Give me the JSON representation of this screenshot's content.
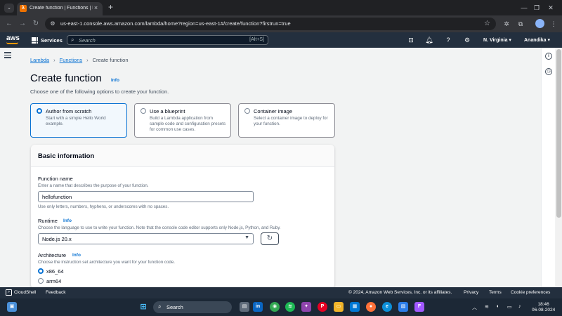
{
  "browser": {
    "tab_title": "Create function | Functions | Lambda",
    "url": "us-east-1.console.aws.amazon.com/lambda/home?region=us-east-1#/create/function?firstrun=true"
  },
  "aws_nav": {
    "logo": "aws",
    "services": "Services",
    "search_placeholder": "Search",
    "search_shortcut": "[Alt+S]",
    "region": "N. Virginia ▾",
    "user": "Anandika ▾"
  },
  "breadcrumb": {
    "lambda": "Lambda",
    "functions": "Functions",
    "current": "Create function"
  },
  "header": {
    "title": "Create function",
    "info": "Info",
    "description": "Choose one of the following options to create your function."
  },
  "options": [
    {
      "title": "Author from scratch",
      "desc": "Start with a simple Hello World example."
    },
    {
      "title": "Use a blueprint",
      "desc": "Build a Lambda application from sample code and configuration presets for common use cases."
    },
    {
      "title": "Container image",
      "desc": "Select a container image to deploy for your function."
    }
  ],
  "basic": {
    "title": "Basic information",
    "function_name_label": "Function name",
    "function_name_desc": "Enter a name that describes the purpose of your function.",
    "function_name_value": "hellofunction",
    "function_name_hint": "Use only letters, numbers, hyphens, or underscores with no spaces.",
    "runtime_label": "Runtime",
    "runtime_info": "Info",
    "runtime_desc": "Choose the language to use to write your function. Note that the console code editor supports only Node.js, Python, and Ruby.",
    "runtime_value": "Node.js 20.x",
    "arch_label": "Architecture",
    "arch_info": "Info",
    "arch_desc": "Choose the instruction set architecture you want for your function code.",
    "arch_options": [
      "x86_64",
      "arm64"
    ]
  },
  "footer": {
    "cloudshell": "CloudShell",
    "feedback": "Feedback",
    "copyright": "© 2024, Amazon Web Services, Inc. or its affiliates.",
    "privacy": "Privacy",
    "terms": "Terms",
    "cookies": "Cookie preferences"
  },
  "taskbar": {
    "search": "Search",
    "time": "18:46",
    "date": "06-08-2024"
  }
}
